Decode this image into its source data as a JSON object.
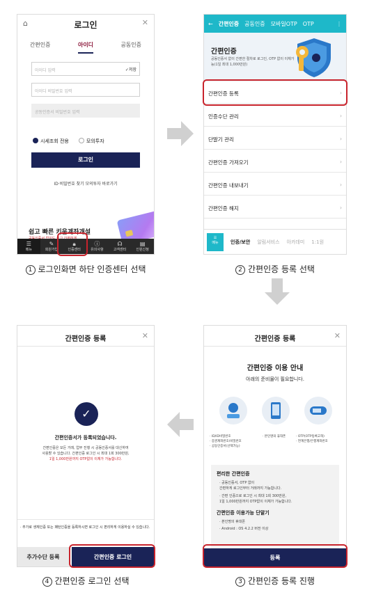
{
  "screen1": {
    "title": "로그인",
    "tabs": [
      "간편인증",
      "아이디",
      "공동인증"
    ],
    "id_placeholder": "아이디 입력",
    "save_label": "저장",
    "pw_placeholder": "아이디 비밀번호 입력",
    "cert_pw_placeholder": "공동인증서 비밀번호 입력",
    "radio_on": "시세조회 전용",
    "radio_off": "모의투자",
    "login_button": "로그인",
    "links": "ID·비밀번호 찾기    모의투자 바로가기",
    "promo_title": "쉽고 빠른 키움계좌개설",
    "promo_sub": "공동인증서 없이도 쉽고 간편하게",
    "nav": [
      "메뉴",
      "회원가입",
      "인증센터",
      "유의사항",
      "고객센터",
      "인원신청"
    ]
  },
  "screen2": {
    "tabs": [
      "간편인증",
      "공동인증",
      "모바일OTP",
      "OTP"
    ],
    "banner_title": "간편인증",
    "banner_sub": "공동인증서 없이 간편한 절차로 로그인, OTP 없이 이체가능(1일 최대 1,000만원)",
    "items": [
      "간편인증 등록",
      "인증수단 관리",
      "단말기 관리",
      "간편인증 가져오기",
      "간편인증 내보내기",
      "간편인증 해지"
    ],
    "bottom_menu": "메뉴",
    "bottom_tabs": [
      "인증/보안",
      "알림서비스",
      "아카데미",
      "1:1원"
    ]
  },
  "screen3": {
    "title": "간편인증 등록",
    "guide_title": "간편인증 이용 안내",
    "guide_sub": "아래의 준비물이 필요합니다.",
    "icon_labels": [
      "· ID/ID비밀번호\n· 증권계좌번호/비밀번호\n· 공동인증서(선택가능)",
      "· 본인명의 휴대폰",
      "· OTP(OTP등록고객)\n· 연계은행/은행계좌번호"
    ],
    "sec1_title": "편리한 간편인증",
    "sec1_lines": [
      "· 공동인증서, OTP 없이",
      "  간편하게 로그인부터 거래까지 가능합니다.",
      "· 간편 인증으로 로그인 시 최대 1회 300만원,",
      "  1일 1,000만원까지 OTP없이 이체가 가능합니다."
    ],
    "sec2_title": "간편인증 이용가능 단말기",
    "sec2_lines": [
      "· 본인명의 휴대폰",
      "· Android : OS 4.2.2 버전 이상"
    ],
    "register_button": "등록"
  },
  "screen4": {
    "title": "간편인증 등록",
    "done_title": "간편인증서가 등록되었습니다.",
    "done_body1": "간편인증은 모든 거래, 업무 진행 시 공동인증서를 대신하여",
    "done_body2": "사용할 수 있습니다. 간편인증 로그인 시 최대 1회 300만원,",
    "done_body3": "1일 1,000만원까지 OTP없이 이체가 가능합니다.",
    "bottom_note": "· 추가로 생체인증 또는 패턴인증을 등록하시면 로그인 시 편리하게 이용하실 수 있습니다.",
    "btn_add": "추가수단 등록",
    "btn_login": "간편인증 로그인"
  },
  "captions": {
    "c1": "로그인화면 하단 인증센터 선택",
    "c2": "간편인증 등록 선택",
    "c3": "간편인증 등록 진행",
    "c4": "간편인증 로그인 선택",
    "n1": "1",
    "n2": "2",
    "n3": "3",
    "n4": "4"
  },
  "colors": {
    "navy": "#1a2357",
    "teal": "#1eb8c9",
    "highlight_red": "#c8232c",
    "arrow_grey": "#d0d0d0"
  }
}
